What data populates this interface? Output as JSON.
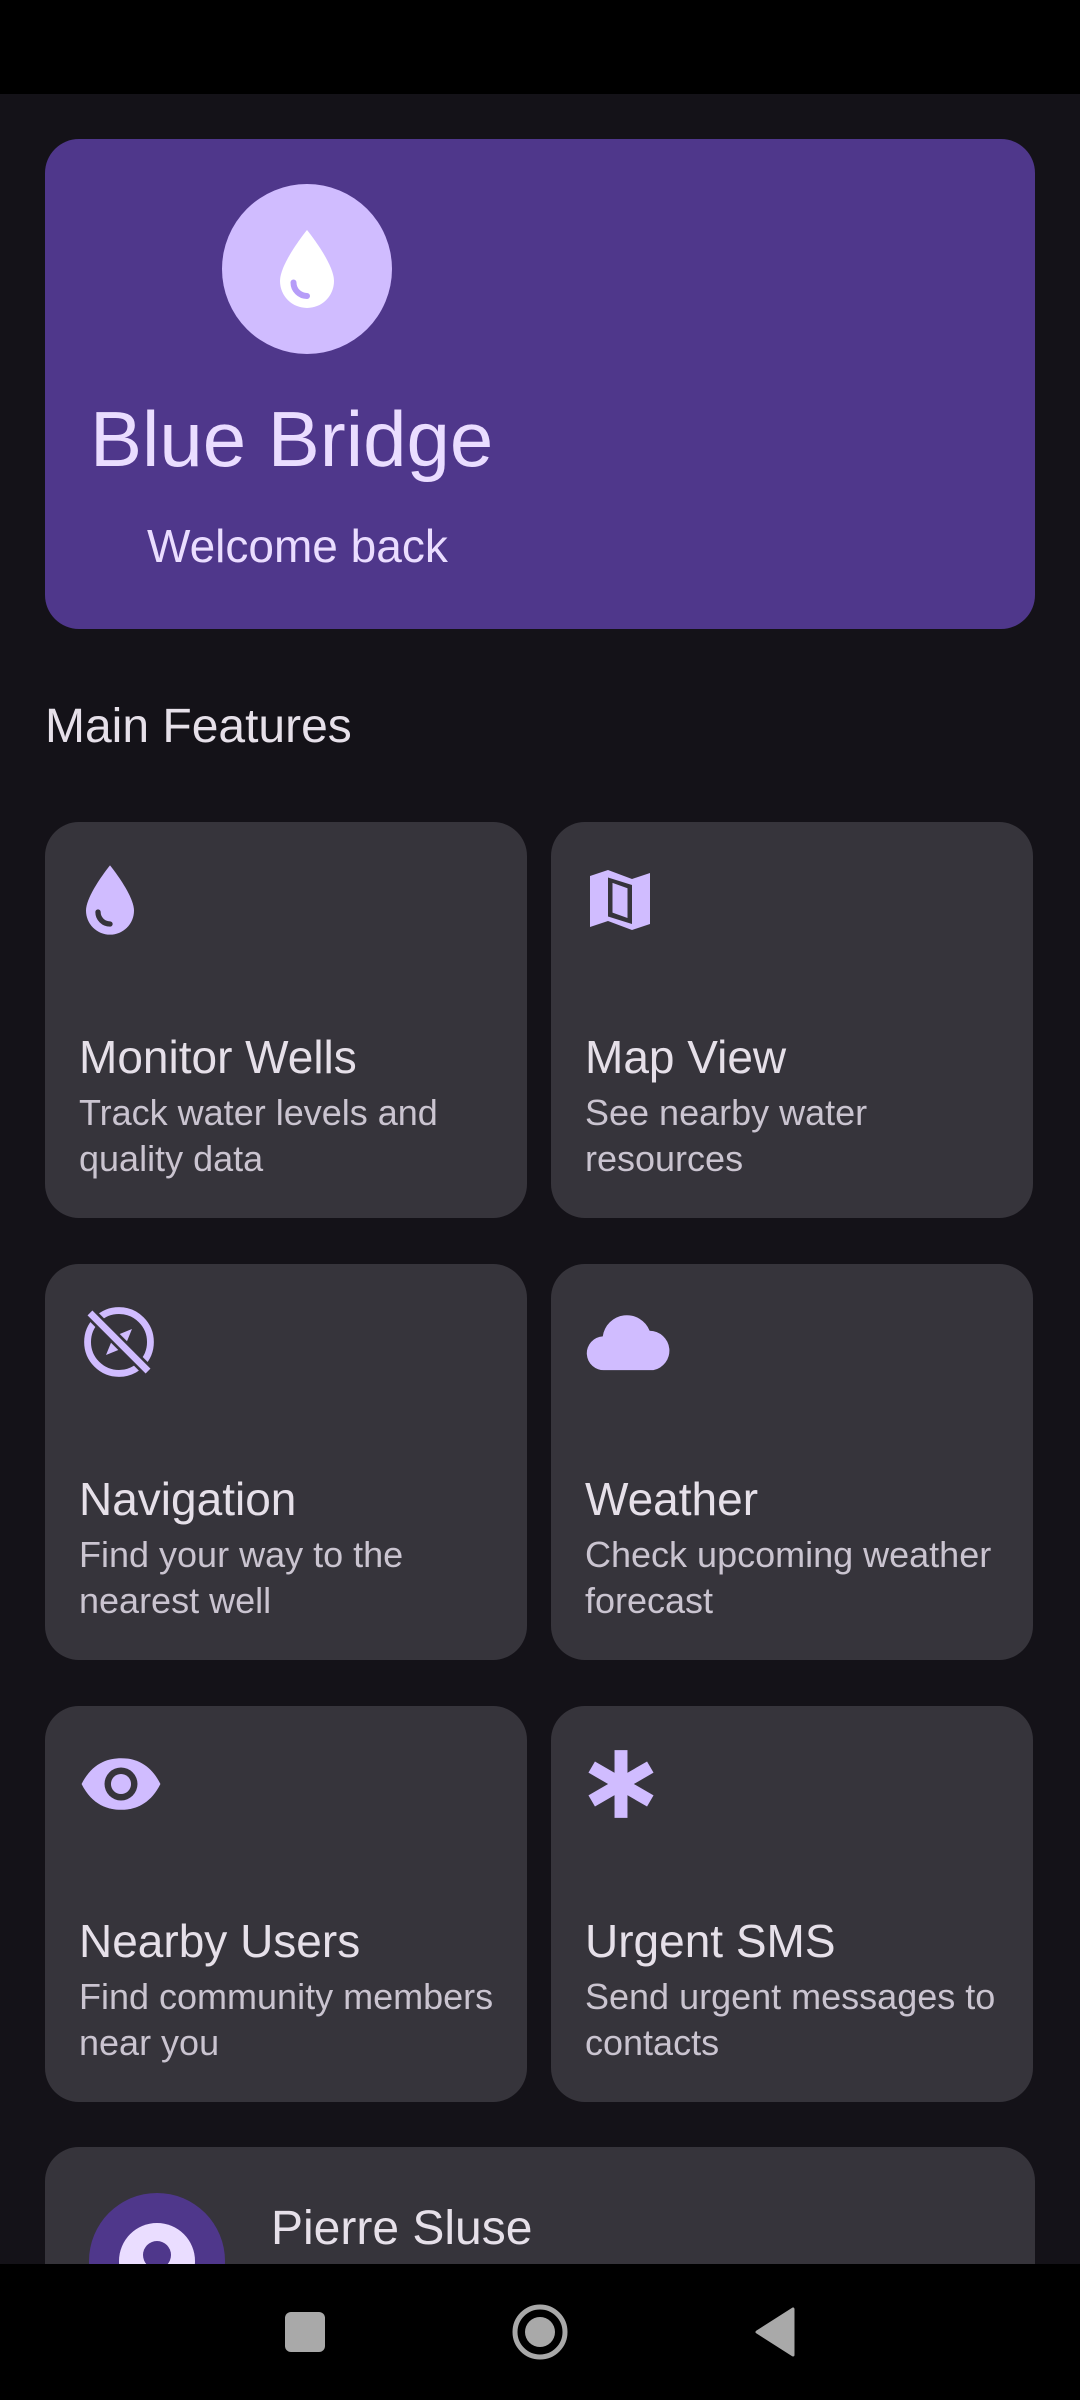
{
  "app": {
    "title": "Blue Bridge",
    "subtitle": "Welcome back",
    "hero_icon": "water-drop-icon"
  },
  "section": {
    "title": "Main Features"
  },
  "features": [
    {
      "title": "Monitor Wells",
      "description": "Track water levels and quality data",
      "icon": "water-drop-icon"
    },
    {
      "title": "Map View",
      "description": "See nearby water resources",
      "icon": "map-icon"
    },
    {
      "title": "Navigation",
      "description": "Find your way to the nearest well",
      "icon": "explore-off-icon"
    },
    {
      "title": "Weather",
      "description": "Check upcoming weather forecast",
      "icon": "cloud-icon"
    },
    {
      "title": "Nearby Users",
      "description": "Find community members near you",
      "icon": "eye-icon"
    },
    {
      "title": "Urgent SMS",
      "description": "Send urgent messages to contacts",
      "icon": "asterisk-icon"
    }
  ],
  "profile": {
    "name": "Pierre Sluse",
    "icon": "person-icon"
  },
  "navigation": {
    "recents": "recents-icon",
    "home": "home-icon",
    "back": "back-icon"
  },
  "colors": {
    "background": "#141218",
    "hero": "#4F378B",
    "card": "#36343B",
    "accent": "#D0BCFF",
    "hero_text": "#EADDFF"
  }
}
